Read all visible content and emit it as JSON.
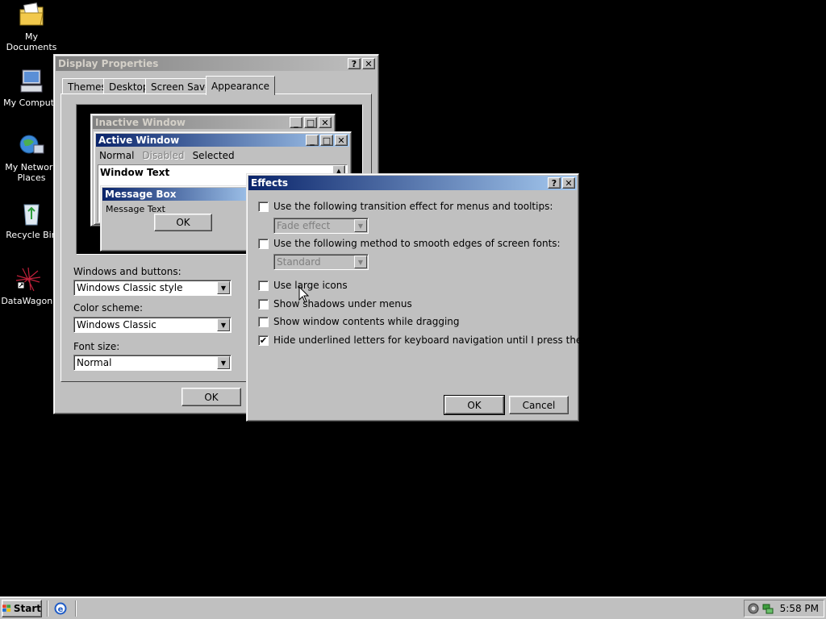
{
  "desktop": {
    "icons": [
      {
        "label": "My Documents",
        "icon": "folder-documents-icon"
      },
      {
        "label": "My Compute",
        "icon": "computer-icon"
      },
      {
        "label": "My Network\nPlaces",
        "icon": "network-icon"
      },
      {
        "label": "Recycle Bin",
        "icon": "recycle-bin-icon"
      },
      {
        "label": "DataWagon.",
        "icon": "datawagon-shortcut-icon"
      }
    ]
  },
  "display_properties": {
    "title": "Display Properties",
    "help": "?",
    "close": "✕",
    "tabs": [
      "Themes",
      "Desktop",
      "Screen Saver",
      "Appearance"
    ],
    "active_tab": "Appearance",
    "preview": {
      "inactive_title": "Inactive Window",
      "active_title": "Active Window",
      "menu": [
        "Normal",
        "Disabled",
        "Selected"
      ],
      "window_text": "Window Text",
      "msgbox_title": "Message Box",
      "msgbox_text": "Message Text",
      "msgbox_ok": "OK"
    },
    "windows_buttons_label": "Windows and buttons:",
    "windows_buttons_value": "Windows Classic style",
    "color_scheme_label": "Color scheme:",
    "color_scheme_value": "Windows Classic",
    "font_size_label": "Font size:",
    "font_size_value": "Normal",
    "ok": "OK"
  },
  "effects": {
    "title": "Effects",
    "help": "?",
    "close": "✕",
    "options": [
      {
        "label": "Use the following transition effect for menus and tooltips:",
        "checked": false
      },
      {
        "label": "Use the following method to smooth edges of screen fonts:",
        "checked": false
      },
      {
        "label": "Use large icons",
        "checked": false
      },
      {
        "label": "Show shadows under menus",
        "checked": false
      },
      {
        "label": "Show window contents while dragging",
        "checked": false
      },
      {
        "label": "Hide underlined letters for keyboard navigation until I press the Alt key",
        "checked": true
      }
    ],
    "transition_value": "Fade effect",
    "smooth_value": "Standard",
    "ok": "OK",
    "cancel": "Cancel"
  },
  "taskbar": {
    "start": "Start",
    "clock": "5:58 PM"
  },
  "colors": {
    "active_title_start": "#0a246a",
    "active_title_end": "#a6caf0",
    "inactive_title_start": "#808080",
    "face": "#c0c0c0",
    "desktop": "#000000"
  }
}
